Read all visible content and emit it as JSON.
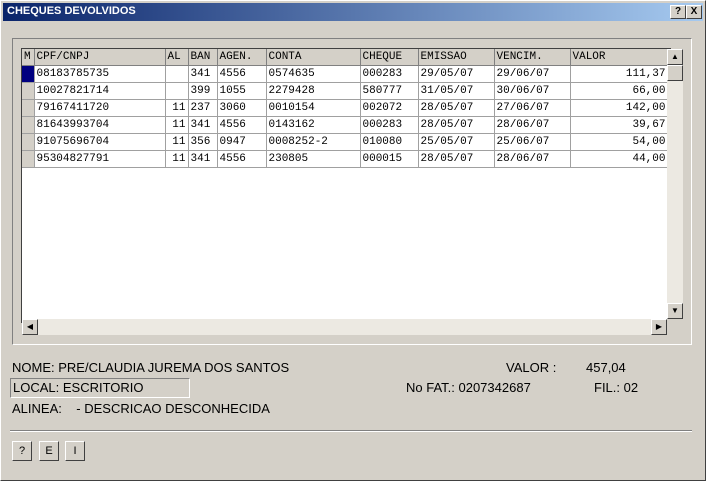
{
  "window": {
    "title": "CHEQUES DEVOLVIDOS",
    "help_label": "?",
    "close_label": "X"
  },
  "table": {
    "columns": [
      "M",
      "CPF/CNPJ",
      "AL",
      "BAN",
      "AGEN.",
      "CONTA",
      "CHEQUE",
      "EMISSAO",
      "VENCIM.",
      "VALOR"
    ],
    "rows": [
      [
        "08183785735",
        "",
        "341",
        "4556",
        "0574635",
        "000283",
        "29/05/07",
        "29/06/07",
        "111,37"
      ],
      [
        "10027821714",
        "",
        "399",
        "1055",
        "2279428",
        "580777",
        "31/05/07",
        "30/06/07",
        "66,00"
      ],
      [
        "79167411720",
        "11",
        "237",
        "3060",
        "0010154",
        "002072",
        "28/05/07",
        "27/06/07",
        "142,00"
      ],
      [
        "81643993704",
        "11",
        "341",
        "4556",
        "0143162",
        "000283",
        "28/05/07",
        "28/06/07",
        "39,67"
      ],
      [
        "91075696704",
        "11",
        "356",
        "0947",
        "0008252-2",
        "010080",
        "25/05/07",
        "25/06/07",
        "54,00"
      ],
      [
        "95304827791",
        "11",
        "341",
        "4556",
        "230805",
        "000015",
        "28/05/07",
        "28/06/07",
        "44,00"
      ]
    ],
    "selected_row": 0
  },
  "info": {
    "nome": "NOME: PRE/CLAUDIA JUREMA DOS SANTOS",
    "valor_label": "VALOR :",
    "valor": "457,04",
    "local": "LOCAL: ESCRITORIO",
    "nfat": "No FAT.: 0207342687",
    "fil": "FIL.: 02",
    "alinea": "ALINEA:    - DESCRICAO DESCONHECIDA"
  },
  "buttons": {
    "help": "?",
    "e": "E",
    "i": "I"
  }
}
